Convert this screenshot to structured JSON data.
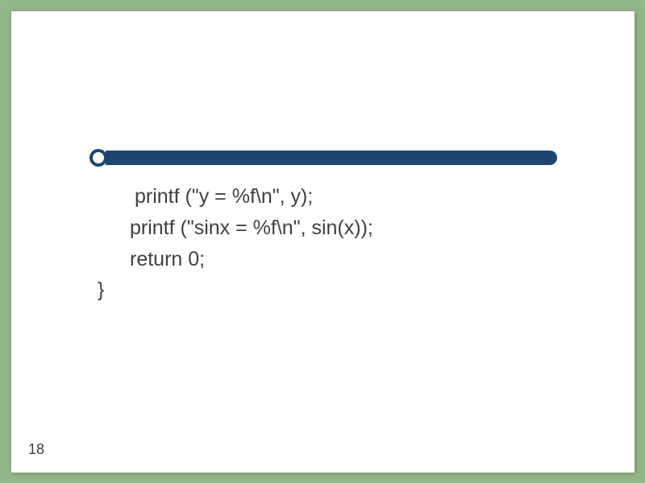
{
  "slide": {
    "code": {
      "line1": "printf (\"y = %f\\n\", y);",
      "line2": "printf (\"sinx = %f\\n\", sin(x));",
      "line3": "return 0;",
      "line4": "}"
    },
    "page_number": "18"
  }
}
